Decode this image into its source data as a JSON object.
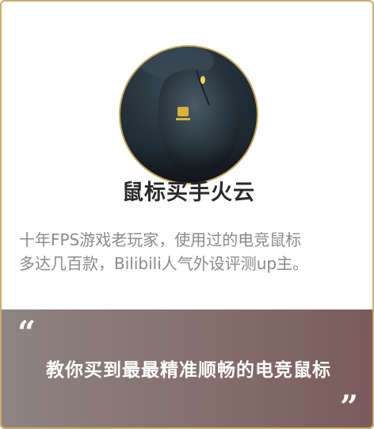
{
  "profile": {
    "name": "鼠标买手火云",
    "description_line1": "十年FPS游戏老玩家，使用过的电竞鼠标",
    "description_line2": "多达几百款，Bilibili人气外设评测up主。",
    "avatar_icon": "gaming-mouse-photo"
  },
  "quote": {
    "open_mark": "“",
    "text": "教你买到最最精准顺畅的电竞鼠标",
    "close_mark": "”"
  },
  "colors": {
    "card_border": "#c9ad6a",
    "avatar_ring": "#c6a55c",
    "quote_band_start": "#8e8383",
    "quote_band_end": "#7a5b5b"
  }
}
